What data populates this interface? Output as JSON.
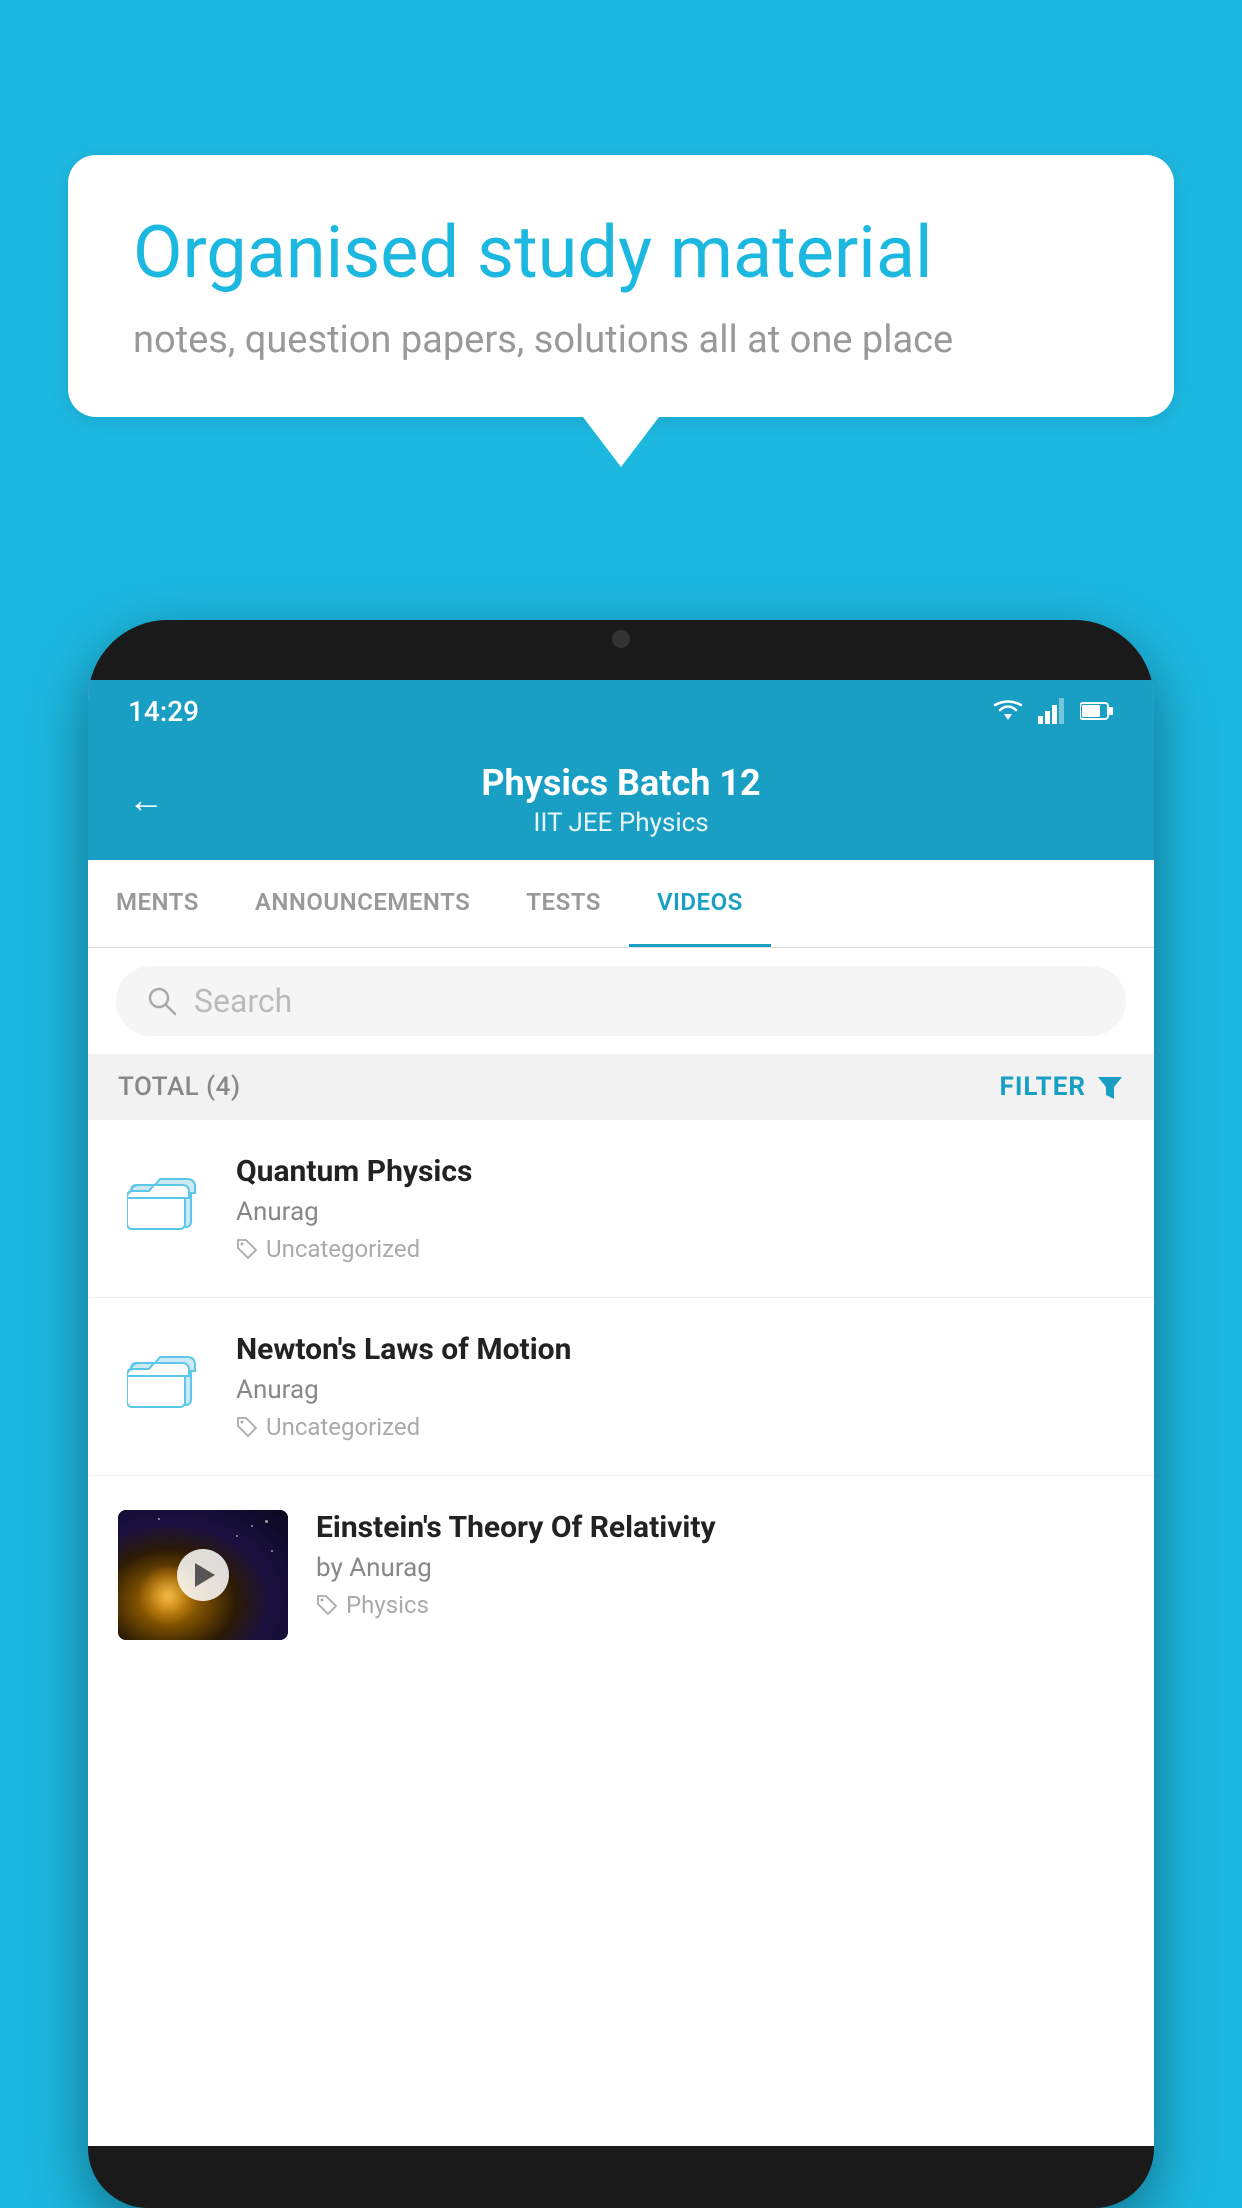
{
  "background": {
    "color": "#1db8e0"
  },
  "speech_bubble": {
    "title": "Organised study material",
    "subtitle": "notes, question papers, solutions all at one place"
  },
  "status_bar": {
    "time": "14:29",
    "wifi": "▾",
    "signal": "▴",
    "battery": "▌"
  },
  "header": {
    "title": "Physics Batch 12",
    "subtitle": "IIT JEE   Physics",
    "back_label": "←"
  },
  "tabs": [
    {
      "label": "MENTS",
      "active": false
    },
    {
      "label": "ANNOUNCEMENTS",
      "active": false
    },
    {
      "label": "TESTS",
      "active": false
    },
    {
      "label": "VIDEOS",
      "active": true
    }
  ],
  "search": {
    "placeholder": "Search"
  },
  "filter_row": {
    "total": "TOTAL (4)",
    "filter_label": "FILTER"
  },
  "videos": [
    {
      "title": "Quantum Physics",
      "author": "Anurag",
      "tag": "Uncategorized",
      "type": "folder"
    },
    {
      "title": "Newton's Laws of Motion",
      "author": "Anurag",
      "tag": "Uncategorized",
      "type": "folder"
    },
    {
      "title": "Einstein's Theory Of Relativity",
      "author": "by Anurag",
      "tag": "Physics",
      "type": "video"
    }
  ]
}
